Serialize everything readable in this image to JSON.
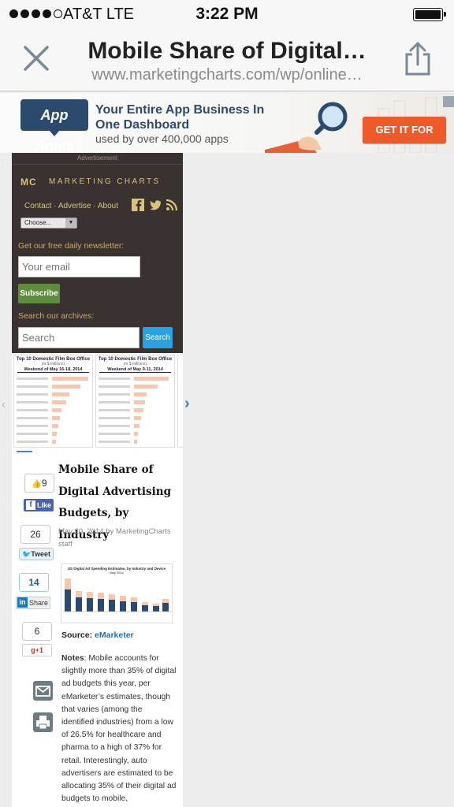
{
  "status_bar": {
    "carrier": "AT&T  LTE",
    "time": "3:22 PM"
  },
  "browser": {
    "title": "Mobile Share of Digital…",
    "url": "www.marketingcharts.com/wp/online…"
  },
  "ad_banner": {
    "brand": "App Annie",
    "line1": "Your Entire App Business In",
    "line2": "One Dashboard",
    "line3": "used by over 400,000 apps",
    "cta": "GET IT FOR FREE"
  },
  "site": {
    "advertisement_label": "Advertisement",
    "logo_mark": "MC",
    "logo_name": "MARKETING CHARTS",
    "nav": [
      "Contact",
      "Advertise",
      "About"
    ],
    "choose_label": "Choose...",
    "newsletter_label": "Get our free daily newsletter:",
    "email_placeholder": "Your email",
    "subscribe_label": "Subscribe",
    "search_label": "Search our archives:",
    "search_placeholder": "Search",
    "search_button": "Search"
  },
  "carousel": [
    {
      "title": "Top 10 Domestic Film Box Office",
      "subtitle": "(in $ millions)",
      "period": "Weekend of May 16-18, 2014"
    },
    {
      "title": "Top 10 Domestic Film Box Office",
      "subtitle": "(in $ millions)",
      "period": "Weekend of May 9-11, 2014"
    }
  ],
  "social": {
    "like_count": "9",
    "like_label": "Like",
    "tweet_count": "26",
    "tweet_label": "Tweet",
    "share_count": "14",
    "share_label": "Share",
    "gplus_count": "6",
    "gplus_label": "+1"
  },
  "article": {
    "title": "Mobile Share of Digital Advertising Budgets, by Industry",
    "byline": "May 20, 2014 by MarketingCharts staff",
    "chart_title": "US Digital Ad Spending Estimates, by Industry and Device",
    "chart_subtitle": "May 2014",
    "source_label": "Source",
    "source_name": "eMarketer",
    "notes_label": "Notes",
    "notes_text": ": Mobile accounts for slightly more than 35% of digital ad budgets this year, per eMarketer’s estimates, though that varies (among the identified industries) from a low of 26.5% for healthcare and pharma to a high of 37% for retail. Interestingly, auto advertisers are estimated to be allocating 35% of their digital ad budgets to mobile,"
  },
  "colors": {
    "accent_blue": "#2aa2e0",
    "subscribe_green": "#5d8d3a",
    "cta_orange": "#ef5a2a",
    "header_dark": "#3a3230",
    "gold": "#d9c27b"
  }
}
